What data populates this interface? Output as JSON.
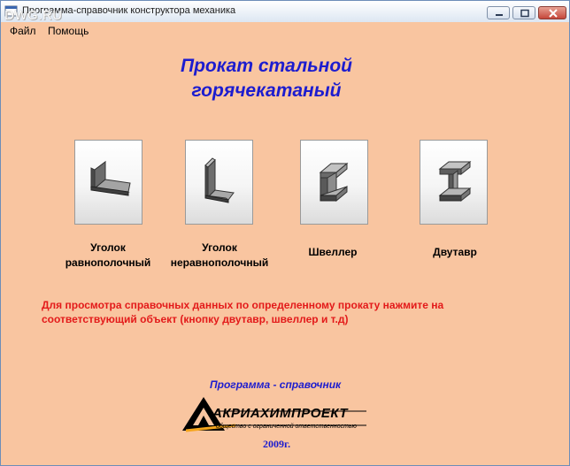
{
  "window": {
    "title": "Программа-справочник конструктора механика",
    "watermark": "DWG.RU"
  },
  "menu": {
    "items": [
      "Файл",
      "Помощь"
    ]
  },
  "heading": {
    "line1": "Прокат стальной",
    "line2": "горячекатаный"
  },
  "profiles": [
    {
      "line1": "Уголок",
      "line2": "равнополочный",
      "icon": "equal-angle-icon"
    },
    {
      "line1": "Уголок",
      "line2": "неравнополочный",
      "icon": "unequal-angle-icon"
    },
    {
      "line1": "Швеллер",
      "line2": "",
      "icon": "channel-icon"
    },
    {
      "line1": "Двутавр",
      "line2": "",
      "icon": "i-beam-icon"
    }
  ],
  "info": {
    "text": "Для просмотра справочных данных по определенному прокату  нажмите на соответствующий объект (кнопку двутавр, швеллер и т.д)"
  },
  "footer": {
    "caption": "Программа - справочник",
    "logo_name": "АКРИАХИМПРОЕКТ",
    "logo_sub": "общество с ограниченной ответственностью",
    "year": "2009г."
  },
  "colors": {
    "background": "#f9c5a0",
    "heading": "#1c1ccf",
    "info": "#e31a1a"
  }
}
